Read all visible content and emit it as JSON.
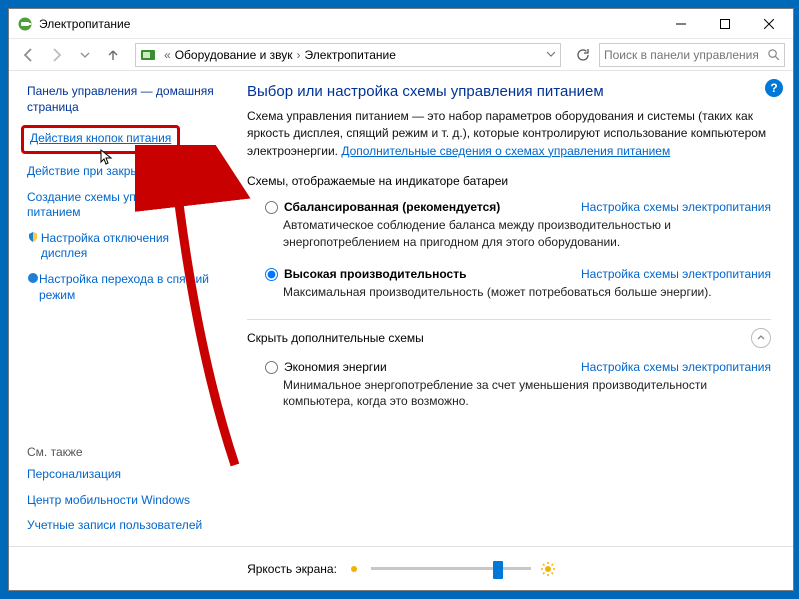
{
  "window": {
    "title": "Электропитание"
  },
  "addrbar": {
    "back_tip": "Назад",
    "crumb_prefix": "«",
    "crumb1": "Оборудование и звук",
    "crumb2": "Электропитание",
    "search_placeholder": "Поиск в панели управления"
  },
  "sidebar": {
    "home": "Панель управления — домашняя страница",
    "links": [
      "Действия кнопок питания",
      "Действие при закрытии крышки",
      "Создание схемы управления питанием",
      "Настройка отключения дисплея",
      "Настройка перехода в спящий режим"
    ],
    "see_also_title": "См. также",
    "see_also": [
      "Персонализация",
      "Центр мобильности Windows",
      "Учетные записи пользователей"
    ]
  },
  "main": {
    "heading": "Выбор или настройка схемы управления питанием",
    "desc_part1": "Схема управления питанием — это набор параметров оборудования и системы (таких как яркость дисплея, спящий режим и т. д.), которые контролируют использование компьютером электроэнергии. ",
    "desc_link": "Дополнительные сведения о схемах управления питанием",
    "group1": "Схемы, отображаемые на индикаторе батареи",
    "group2": "Скрыть дополнительные схемы",
    "plans": [
      {
        "name": "Сбалансированная (рекомендуется)",
        "desc": "Автоматическое соблюдение баланса между производительностью и энергопотреблением на пригодном для этого оборудовании.",
        "link": "Настройка схемы электропитания"
      },
      {
        "name": "Высокая производительность",
        "desc": "Максимальная производительность (может потребоваться больше энергии).",
        "link": "Настройка схемы электропитания"
      },
      {
        "name": "Экономия энергии",
        "desc": "Минимальное энергопотребление за счет уменьшения производительности компьютера, когда это возможно.",
        "link": "Настройка схемы электропитания"
      }
    ],
    "brightness_label": "Яркость экрана:"
  }
}
